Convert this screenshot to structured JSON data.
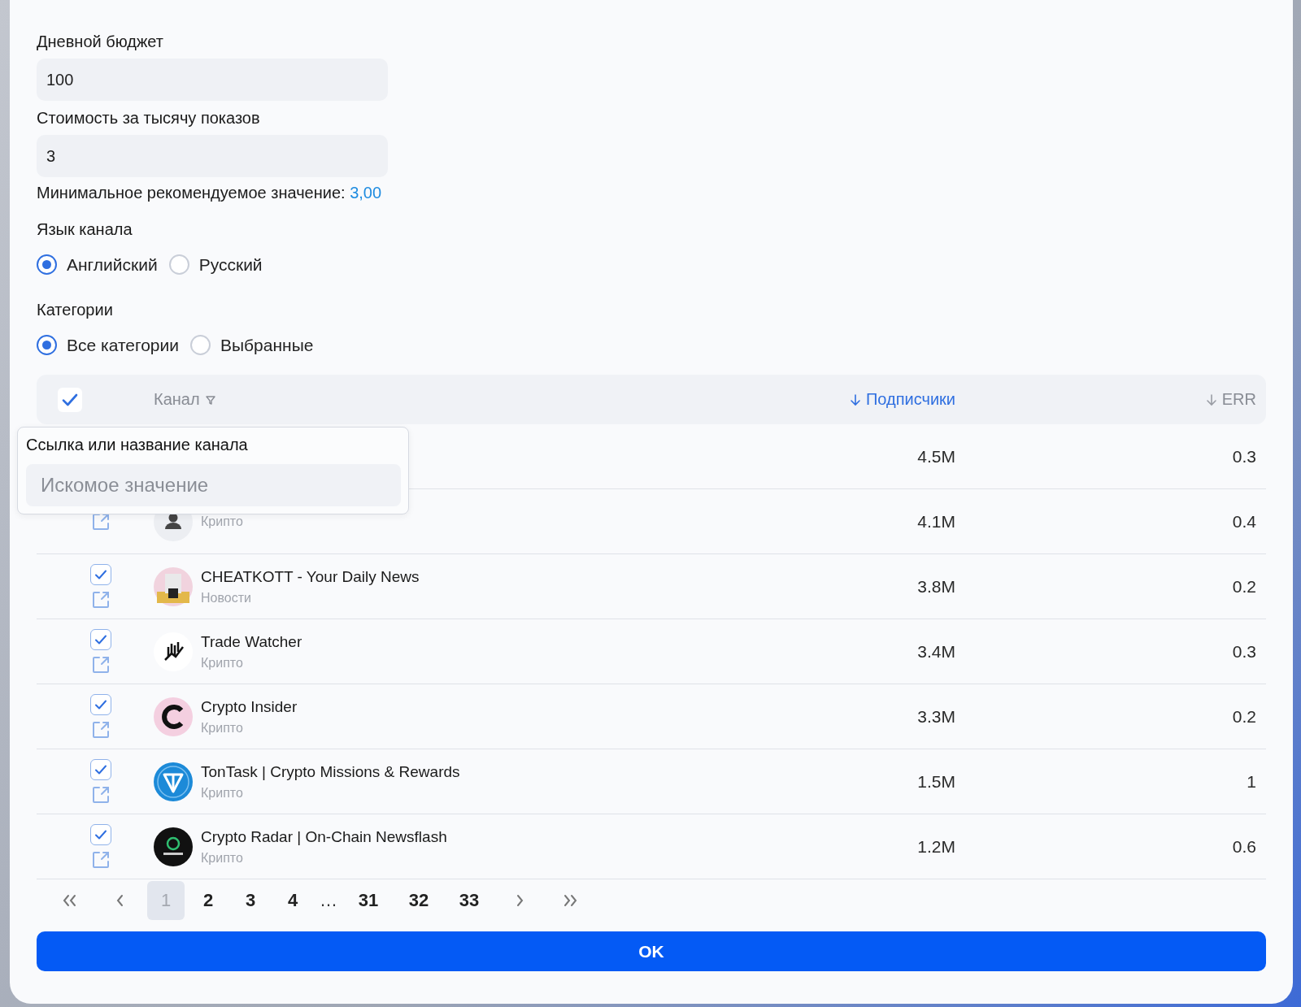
{
  "budget": {
    "label": "Дневной бюджет",
    "value": "100"
  },
  "cpm": {
    "label": "Стоимость за тысячу показов",
    "value": "3",
    "hint": "Минимальное рекомендуемое значение:",
    "hint_value": "3,00"
  },
  "language": {
    "label": "Язык канала",
    "options": [
      {
        "label": "Английский",
        "selected": true
      },
      {
        "label": "Русский",
        "selected": false
      }
    ]
  },
  "categories": {
    "label": "Категории",
    "options": [
      {
        "label": "Все категории",
        "selected": true
      },
      {
        "label": "Выбранные",
        "selected": false
      }
    ]
  },
  "table": {
    "select_all": true,
    "columns": [
      {
        "label": "Канал",
        "kind": "filter",
        "active": false
      },
      {
        "label": "Подписчики",
        "kind": "sort",
        "active": true
      },
      {
        "label": "ERR",
        "kind": "sort",
        "active": false
      }
    ],
    "rows": [
      {
        "kind": "hidden",
        "subscribers": "4.5M",
        "err": "0.3"
      },
      {
        "kind": "person",
        "category": "Крипто",
        "link": true,
        "subscribers": "4.1M",
        "err": "0.4"
      },
      {
        "kind": "photo",
        "checked": true,
        "link": true,
        "name": "CHEATKOTT - Your Daily News",
        "category": "Новости",
        "subscribers": "3.8M",
        "err": "0.2"
      },
      {
        "kind": "chart",
        "checked": true,
        "link": true,
        "name": "Trade Watcher",
        "category": "Крипто",
        "subscribers": "3.4M",
        "err": "0.3"
      },
      {
        "kind": "ring",
        "checked": true,
        "link": true,
        "name": "Crypto Insider",
        "category": "Крипто",
        "subscribers": "3.3M",
        "err": "0.2"
      },
      {
        "kind": "triangle",
        "checked": true,
        "link": true,
        "name": "TonTask | Crypto Missions & Rewards",
        "category": "Крипто",
        "subscribers": "1.5M",
        "err": "1"
      },
      {
        "kind": "dark",
        "checked": true,
        "link": true,
        "name": "Crypto Radar | On-Chain Newsflash",
        "category": "Крипто",
        "subscribers": "1.2M",
        "err": "0.6"
      }
    ]
  },
  "filter_popup": {
    "title": "Ссылка или название канала",
    "placeholder": "Искомое значение"
  },
  "pagination": {
    "pages": [
      {
        "label": "1",
        "selected": true
      },
      {
        "label": "2",
        "selected": false
      },
      {
        "label": "3",
        "selected": false
      },
      {
        "label": "4",
        "selected": false
      },
      {
        "label": "…",
        "kind": "gap"
      },
      {
        "label": "31",
        "selected": false
      },
      {
        "label": "32",
        "selected": false
      },
      {
        "label": "33",
        "selected": false
      }
    ]
  },
  "ok_button": "OK"
}
